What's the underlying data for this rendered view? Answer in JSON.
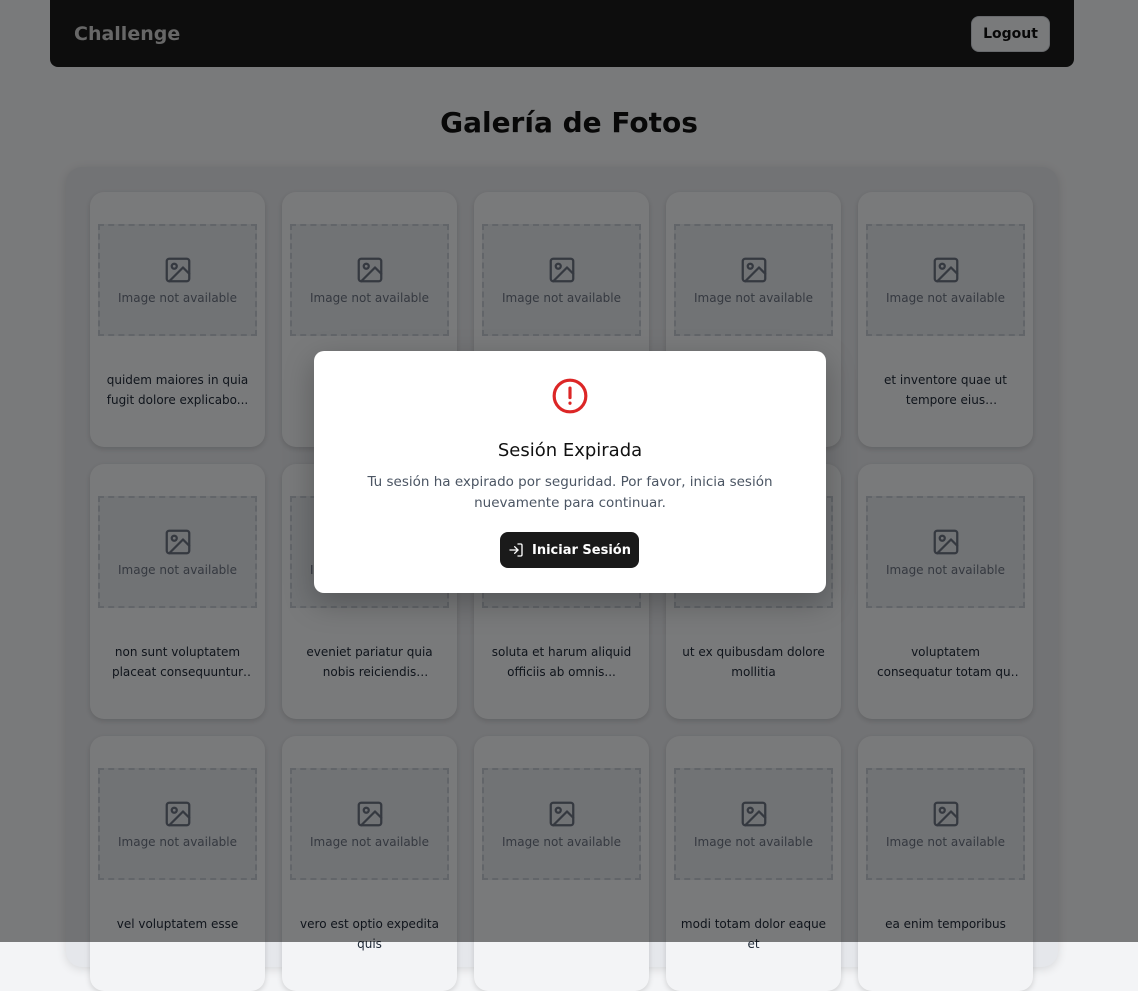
{
  "navbar": {
    "brand": "Challenge",
    "logout_label": "Logout"
  },
  "page": {
    "title": "Galería de Fotos"
  },
  "gallery": {
    "placeholder_text": "Image not available",
    "placeholder_icon": "image-icon",
    "cards": [
      {
        "title": "quidem maiores in quia fugit dolore explicabo..."
      },
      {
        "title": ""
      },
      {
        "title": ""
      },
      {
        "title": ""
      },
      {
        "title": "et inventore quae ut tempore eius voluptatum"
      },
      {
        "title": "non sunt voluptatem placeat consequuntur rem..."
      },
      {
        "title": "eveniet pariatur quia nobis reiciendis laboriosam ea"
      },
      {
        "title": "soluta et harum aliquid officiis ab omnis..."
      },
      {
        "title": "ut ex quibusdam dolore mollitia"
      },
      {
        "title": "voluptatem consequatur totam qui aut iure est vel"
      },
      {
        "title": "vel voluptatem esse"
      },
      {
        "title": "vero est optio expedita quis"
      },
      {
        "title": ""
      },
      {
        "title": "modi totam dolor eaque et"
      },
      {
        "title": "ea enim temporibus"
      }
    ]
  },
  "modal": {
    "icon": "alert-circle-icon",
    "title": "Sesión Expirada",
    "message": "Tu sesión ha expirado por seguridad. Por favor, inicia sesión nuevamente para continuar.",
    "button_label": "Iniciar Sesión",
    "button_icon": "log-in-icon"
  },
  "colors": {
    "navbar_bg": "#1a1a1a",
    "overlay": "rgba(0,0,0,0.5)",
    "alert_red": "#dc2626",
    "button_dark": "#1a1a1a"
  }
}
